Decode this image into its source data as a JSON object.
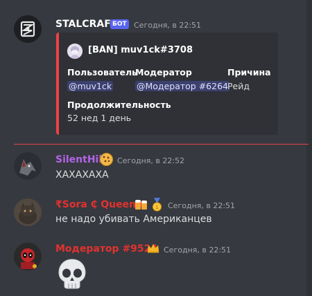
{
  "colors": {
    "background": "#36393f",
    "embed_accent": "#ed4245",
    "bot_tag": "#5865f2",
    "silenthill_name": "#b364e8",
    "sora_name": "#e4312f",
    "moderator_name": "#e4312f",
    "stalcraft_name": "#ffffff"
  },
  "messages": [
    {
      "author": "STALCRAFT",
      "bot_tag": "БОТ",
      "timestamp": "Сегодня, в 22:51",
      "embed": {
        "author": "[BAN] muv1ck#3708",
        "fields": [
          {
            "name": "Пользователь",
            "value": "@muv1ck"
          },
          {
            "name": "Модератор",
            "value": "@Модератор #6264"
          },
          {
            "name": "Причина",
            "value": "Рейд"
          },
          {
            "name": "Продолжительность",
            "value": "52 нед 1 день"
          }
        ]
      }
    },
    {
      "author": "SilentHill",
      "badge_icon": "cookie-icon",
      "timestamp": "Сегодня, в 22:52",
      "text": "ХАХАХАХА"
    },
    {
      "author": "₹Sora ₵ Queen ₵",
      "badge_icons": [
        "beer-icon",
        "medal-icon"
      ],
      "timestamp": "Сегодня, в 22:51",
      "text": "не надо убивать Американцев"
    },
    {
      "author": "Модератор #9524",
      "badge_icon": "crown-icon",
      "timestamp": "Сегодня, в 22:51",
      "text": "💀"
    }
  ]
}
